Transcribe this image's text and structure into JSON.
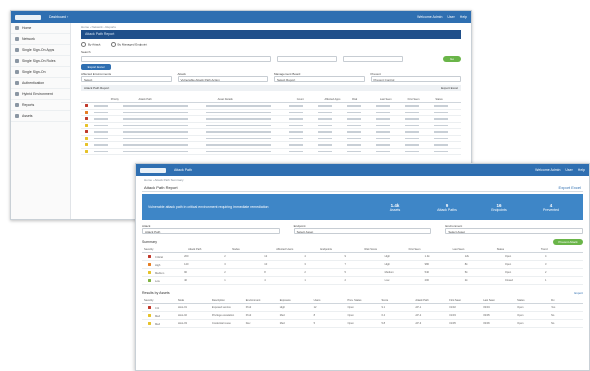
{
  "screen1": {
    "topbar": {
      "breadcrumb": "Dashboard ›",
      "right": [
        "Welcome Admin",
        "User",
        "Help"
      ]
    },
    "sidebar": {
      "items": [
        "Home",
        "Network",
        "Single Sign-On Apps",
        "Single Sign-On Rules",
        "Single Sign-On",
        "Authentication",
        "Hybrid Environment",
        "Reports",
        "Assets"
      ]
    },
    "breadcrumb": "Home › Network › Reports",
    "banner": "Attack Path Report",
    "radios": [
      "By Attack",
      "By Managed Endpoint"
    ],
    "filters": {
      "search_label": "Search",
      "run_label": "Go"
    },
    "export_label": "Export Excel",
    "dropdowns": [
      {
        "label": "Affected Environments",
        "value": "Select"
      },
      {
        "label": "Attack",
        "value": "Vulnerable Attack Path Action"
      },
      {
        "label": "Management Board",
        "value": "Select Report"
      },
      {
        "label": "Prevent",
        "value": "Prevent Control"
      }
    ],
    "table_title": "Attack Path Report",
    "table_action": "Export Excel",
    "columns": [
      "",
      "Priority",
      "Attack Path",
      "Asset Details",
      "Count",
      "Affected Apps",
      "Risk",
      "Last Seen",
      "First Seen",
      "Status"
    ],
    "row_colors": [
      "#c0392b",
      "#e67e22",
      "#c0392b",
      "#e6c229",
      "#c0392b",
      "#e6c229",
      "#e6c229",
      "#e6c229"
    ]
  },
  "screen2": {
    "topbar": {
      "title": "Attack Path",
      "right": [
        "Welcome Admin",
        "User",
        "Help"
      ]
    },
    "breadcrumb": "Home › Attack Path Summary",
    "page_title": "Attack Path Report",
    "page_action": "Export Excel",
    "hero": {
      "text": "Vulnerable attack path in critical environment requiring immediate remediation",
      "stats": [
        {
          "value": "1.4k",
          "label": "Assets"
        },
        {
          "value": "9",
          "label": "Attack Paths"
        },
        {
          "value": "16",
          "label": "Endpoints"
        },
        {
          "value": "4",
          "label": "Prevented"
        }
      ]
    },
    "selects": [
      {
        "label": "Attack",
        "value": "Attack Path"
      },
      {
        "label": "Endpoint",
        "value": "Select Asset"
      },
      {
        "label": "Environment",
        "value": "Select Asset"
      }
    ],
    "summary_title": "Summary",
    "summary_button": "Prevent Attack",
    "summary_columns": [
      "Severity",
      "Attack Path",
      "Nodes",
      "Affected Users",
      "Endpoints",
      "Risk Score",
      "First Seen",
      "Last Seen",
      "Status",
      "Trend"
    ],
    "summary_rows": [
      {
        "color": "#c0392b",
        "label": "Critical",
        "v": [
          "200",
          "2",
          "12",
          "4",
          "9",
          "High",
          "1.4k",
          "12k",
          "Open",
          "4"
        ]
      },
      {
        "color": "#e67e22",
        "label": "High",
        "v": [
          "140",
          "3",
          "10",
          "3",
          "7",
          "High",
          "980",
          "8k",
          "Open",
          "3"
        ]
      },
      {
        "color": "#e6c229",
        "label": "Medium",
        "v": [
          "90",
          "2",
          "8",
          "2",
          "5",
          "Medium",
          "540",
          "5k",
          "Open",
          "2"
        ]
      },
      {
        "color": "#7fb342",
        "label": "Low",
        "v": [
          "40",
          "1",
          "4",
          "1",
          "2",
          "Low",
          "200",
          "2k",
          "Closed",
          "1"
        ]
      }
    ],
    "details_title": "Results by Assets",
    "details_action": "Export",
    "details_columns": [
      "Severity",
      "Node",
      "Description",
      "Environment",
      "Exposure",
      "Users",
      "Prev. Status",
      "Score",
      "Attack Path",
      "First Seen",
      "Last Seen",
      "Status",
      "Fix"
    ],
    "details_rows": [
      {
        "color": "#c0392b",
        "label": "Crit",
        "v": [
          "Host-01",
          "Exposed service",
          "Prod",
          "High",
          "12",
          "Open",
          "9.1",
          "AP-1",
          "01/02",
          "03/04",
          "Open",
          "Yes"
        ]
      },
      {
        "color": "#e6c229",
        "label": "Med",
        "v": [
          "Host-02",
          "Privilege escalation",
          "Prod",
          "Med",
          "8",
          "Open",
          "6.4",
          "AP-2",
          "01/03",
          "03/05",
          "Open",
          "No"
        ]
      },
      {
        "color": "#e6c229",
        "label": "Med",
        "v": [
          "Host-03",
          "Credential reuse",
          "Dev",
          "Med",
          "5",
          "Open",
          "5.8",
          "AP-3",
          "01/05",
          "03/06",
          "Open",
          "No"
        ]
      }
    ]
  }
}
